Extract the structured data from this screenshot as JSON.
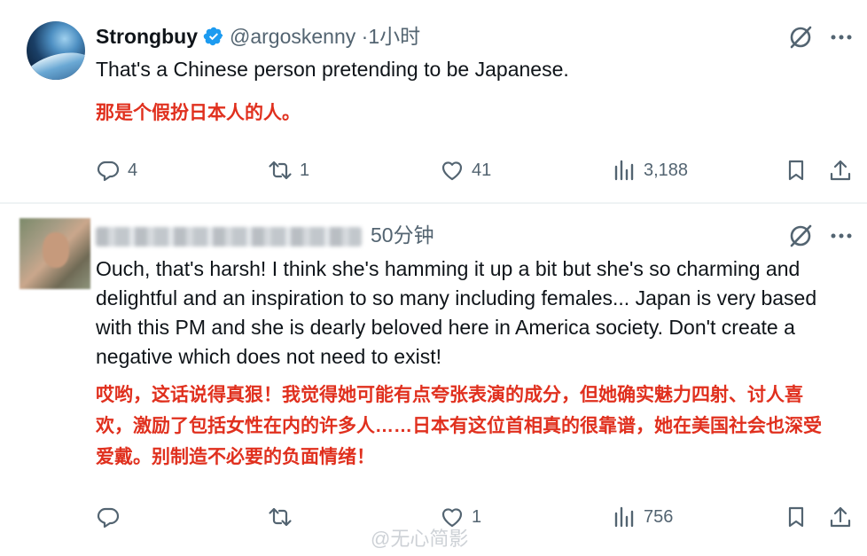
{
  "post1": {
    "name": "Strongbuy",
    "handle": "@argoskenny",
    "separator": "·",
    "time": "1小时",
    "text_en": "That's a Chinese person pretending to be Japanese.",
    "text_cn": "那是个假扮日本人的人。",
    "actions": {
      "replies": "4",
      "reposts": "1",
      "likes": "41",
      "views": "3,188"
    }
  },
  "post2": {
    "time": "50分钟",
    "text_en": "Ouch, that's harsh! I think she's hamming it up a bit but she's so charming and delightful and an inspiration to so many including females... Japan is very based with this PM and she is dearly beloved here in America society. Don't create a negative which does not need to exist!",
    "text_cn": "哎哟，这话说得真狠！我觉得她可能有点夸张表演的成分，但她确实魅力四射、讨人喜欢，激励了包括女性在内的许多人……日本有这位首相真的很靠谱，她在美国社会也深受爱戴。别制造不必要的负面情绪！",
    "actions": {
      "replies": "",
      "reposts": "",
      "likes": "1",
      "views": "756"
    }
  },
  "watermark": "@无心简影",
  "colors": {
    "accent": "#1d9bf0",
    "muted": "#536471",
    "translation": "#e0301e"
  }
}
